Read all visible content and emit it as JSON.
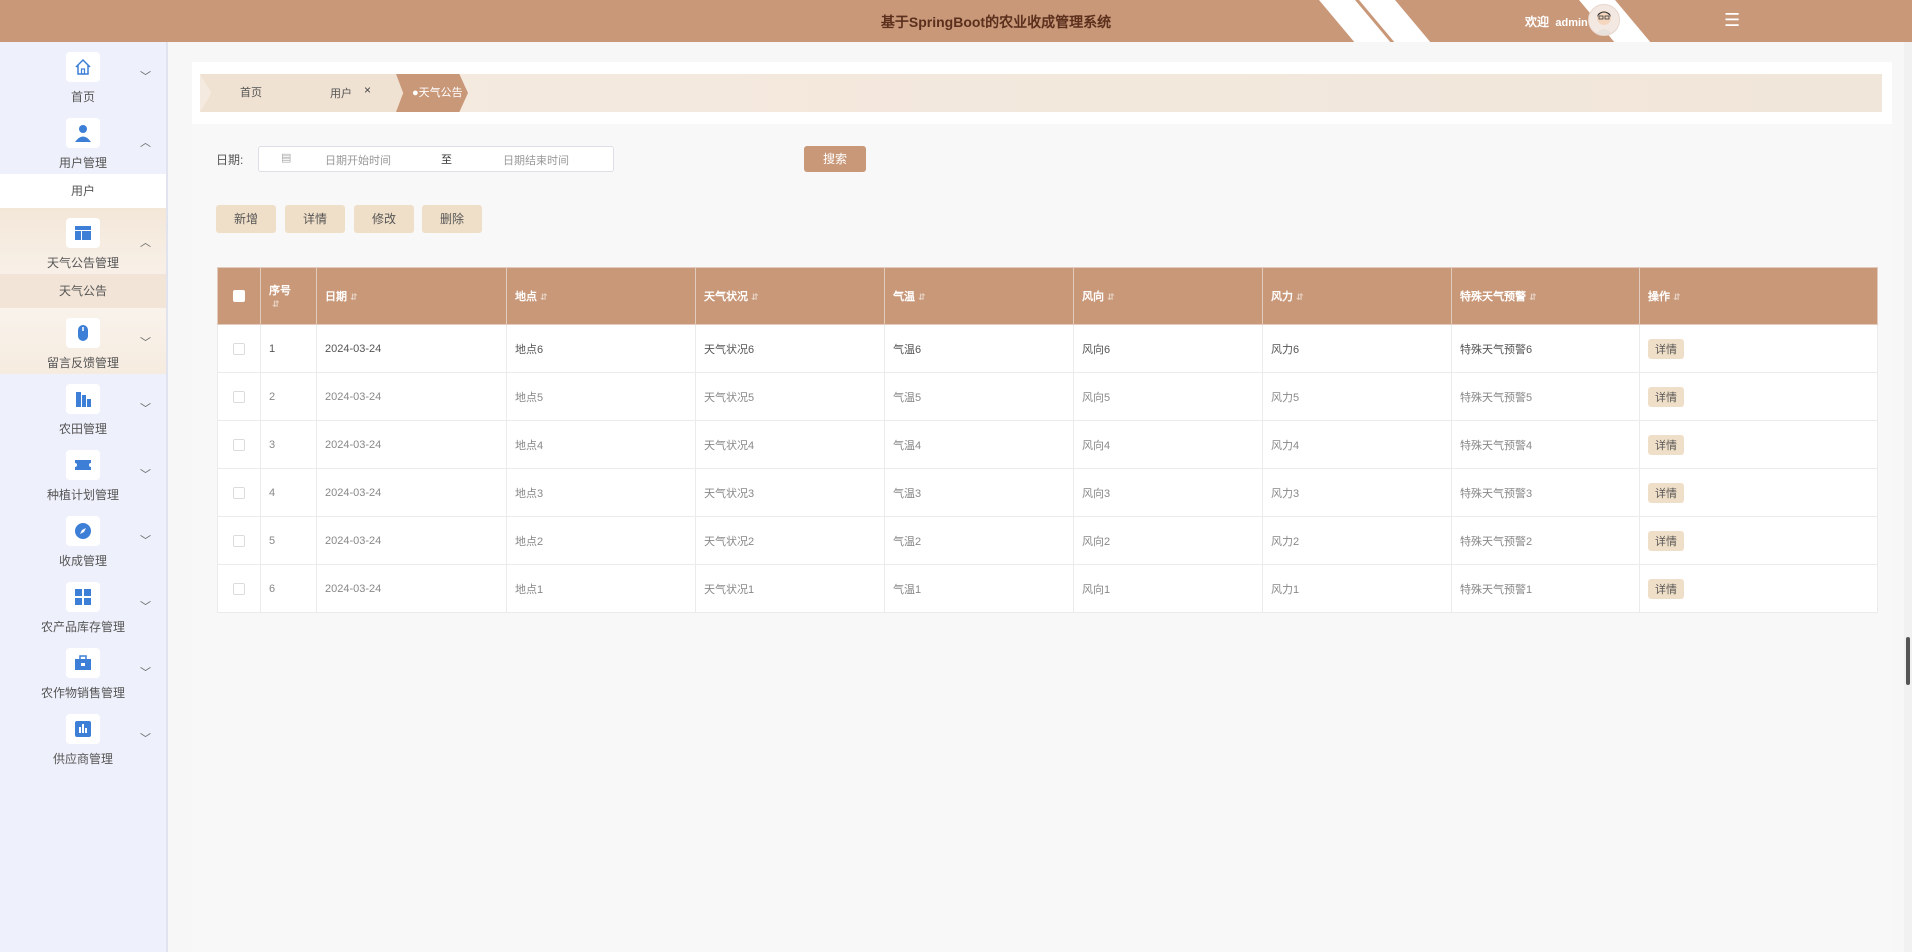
{
  "header": {
    "title": "基于SpringBoot的农业收成管理系统",
    "welcome_prefix": "欢迎",
    "username": "admin"
  },
  "sidebar": {
    "groups": [
      {
        "label": "首页",
        "icon": "home-icon"
      },
      {
        "label": "用户管理",
        "icon": "user-icon",
        "sub": [
          "用户"
        ]
      },
      {
        "label": "天气公告管理",
        "icon": "layout-icon",
        "sub": [
          "天气公告"
        ]
      },
      {
        "label": "留言反馈管理",
        "icon": "mouse-icon"
      },
      {
        "label": "农田管理",
        "icon": "building-icon"
      },
      {
        "label": "种植计划管理",
        "icon": "ticket-icon"
      },
      {
        "label": "收成管理",
        "icon": "compass-icon"
      },
      {
        "label": "农产品库存管理",
        "icon": "grid-icon"
      },
      {
        "label": "农作物销售管理",
        "icon": "briefcase-icon"
      },
      {
        "label": "供应商管理",
        "icon": "chart-icon"
      }
    ]
  },
  "tabs": [
    {
      "label": "首页"
    },
    {
      "label": "用户",
      "close": "×"
    },
    {
      "label": "●天气公告",
      "close": "×"
    }
  ],
  "filters": {
    "date_label": "日期:",
    "start_placeholder": "日期开始时间",
    "separator": "至",
    "end_placeholder": "日期结束时间",
    "search_label": "搜索"
  },
  "actions": {
    "add": "新增",
    "detail": "详情",
    "edit": "修改",
    "delete": "删除"
  },
  "table": {
    "columns": [
      "序号",
      "日期",
      "地点",
      "天气状况",
      "气温",
      "风向",
      "风力",
      "特殊天气预警",
      "操作"
    ],
    "rows": [
      {
        "no": "1",
        "date": "2024-03-24",
        "place": "地点6",
        "weather": "天气状况6",
        "temp": "气温6",
        "wind_dir": "风向6",
        "wind_force": "风力6",
        "warning": "特殊天气预警6",
        "op": "详情"
      },
      {
        "no": "2",
        "date": "2024-03-24",
        "place": "地点5",
        "weather": "天气状况5",
        "temp": "气温5",
        "wind_dir": "风向5",
        "wind_force": "风力5",
        "warning": "特殊天气预警5",
        "op": "详情"
      },
      {
        "no": "3",
        "date": "2024-03-24",
        "place": "地点4",
        "weather": "天气状况4",
        "temp": "气温4",
        "wind_dir": "风向4",
        "wind_force": "风力4",
        "warning": "特殊天气预警4",
        "op": "详情"
      },
      {
        "no": "4",
        "date": "2024-03-24",
        "place": "地点3",
        "weather": "天气状况3",
        "temp": "气温3",
        "wind_dir": "风向3",
        "wind_force": "风力3",
        "warning": "特殊天气预警3",
        "op": "详情"
      },
      {
        "no": "5",
        "date": "2024-03-24",
        "place": "地点2",
        "weather": "天气状况2",
        "temp": "气温2",
        "wind_dir": "风向2",
        "wind_force": "风力2",
        "warning": "特殊天气预警2",
        "op": "详情"
      },
      {
        "no": "6",
        "date": "2024-03-24",
        "place": "地点1",
        "weather": "天气状况1",
        "temp": "气温1",
        "wind_dir": "风向1",
        "wind_force": "风力1",
        "warning": "特殊天气预警1",
        "op": "详情"
      }
    ]
  },
  "colors": {
    "brand": "#c99879",
    "button_light": "#f0dfc8",
    "sidebar_bg": "#eef0fb",
    "icon_blue": "#3d7fd6"
  }
}
